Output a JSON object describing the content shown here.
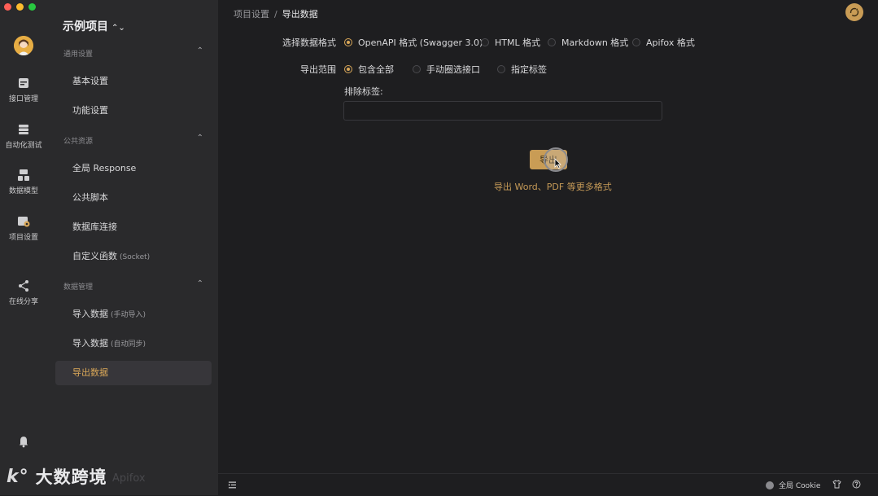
{
  "rail": {
    "items": [
      {
        "label": "接口管理",
        "icon": "api-icon"
      },
      {
        "label": "自动化测试",
        "icon": "automation-icon"
      },
      {
        "label": "数据模型",
        "icon": "data-model-icon"
      },
      {
        "label": "项目设置",
        "icon": "project-settings-icon"
      },
      {
        "label": "在线分享",
        "icon": "share-icon"
      }
    ]
  },
  "sidebar": {
    "project_title": "示例项目",
    "groups": [
      {
        "title": "通用设置",
        "items": [
          {
            "label": "基本设置"
          },
          {
            "label": "功能设置"
          }
        ]
      },
      {
        "title": "公共资源",
        "items": [
          {
            "label": "全局 Response"
          },
          {
            "label": "公共脚本"
          },
          {
            "label": "数据库连接"
          },
          {
            "label": "自定义函数",
            "sub": "(Socket)"
          }
        ]
      },
      {
        "title": "数据管理",
        "items": [
          {
            "label": "导入数据",
            "sub": "(手动导入)"
          },
          {
            "label": "导入数据",
            "sub": "(自动同步)"
          },
          {
            "label": "导出数据"
          }
        ]
      }
    ]
  },
  "watermark": {
    "brand": "大数跨境",
    "apifox": "Apifox"
  },
  "breadcrumb": {
    "parent": "项目设置",
    "separator": "/",
    "current": "导出数据"
  },
  "export": {
    "format_label": "选择数据格式",
    "formats": [
      {
        "label": "OpenAPI 格式 (Swagger 3.0)",
        "checked": true
      },
      {
        "label": "HTML 格式",
        "checked": false
      },
      {
        "label": "Markdown 格式",
        "checked": false
      },
      {
        "label": "Apifox 格式",
        "checked": false
      }
    ],
    "scope_label": "导出范围",
    "scopes": [
      {
        "label": "包含全部",
        "checked": true
      },
      {
        "label": "手动圈选接口",
        "checked": false
      },
      {
        "label": "指定标签",
        "checked": false
      }
    ],
    "exclude_label": "排除标签:",
    "exclude_value": "",
    "button_label": "导出",
    "more_link": "导出 Word、PDF 等更多格式"
  },
  "statusbar": {
    "cookie_label": "全局 Cookie"
  },
  "colors": {
    "accent": "#d9a758",
    "button": "#c99c55",
    "background": "#1e1e20",
    "sidebar": "#2a2a2c"
  }
}
